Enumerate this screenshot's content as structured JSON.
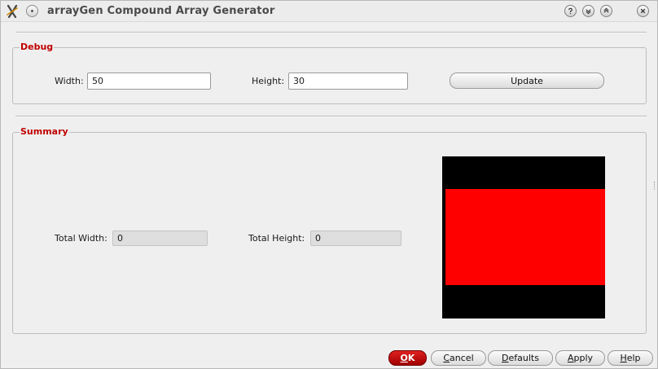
{
  "window": {
    "title": "arrayGen Compound Array Generator"
  },
  "debug": {
    "legend": "Debug",
    "width_label": "Width:",
    "width_value": "50",
    "height_label": "Height:",
    "height_value": "30",
    "update_label": "Update"
  },
  "summary": {
    "legend": "Summary",
    "total_width_label": "Total Width:",
    "total_width_value": "0",
    "total_height_label": "Total Height:",
    "total_height_value": "0"
  },
  "preview": {
    "background_color": "#000000",
    "array_color": "#ff0000"
  },
  "footer": {
    "ok": {
      "mnemonic": "O",
      "rest": "K"
    },
    "cancel": {
      "mnemonic": "C",
      "rest": "ancel"
    },
    "defaults": {
      "mnemonic": "D",
      "rest": "efaults"
    },
    "apply": {
      "mnemonic": "A",
      "rest": "pply"
    },
    "help": {
      "mnemonic": "H",
      "rest": "elp"
    }
  },
  "colors": {
    "legend": "#c00000",
    "primary_button": "#c00000"
  },
  "icons": {
    "app": "compass-icon",
    "pin": "pin-icon",
    "help": "question-icon",
    "minimize": "chevron-down-icon",
    "maximize": "chevron-up-icon",
    "close": "close-icon"
  }
}
